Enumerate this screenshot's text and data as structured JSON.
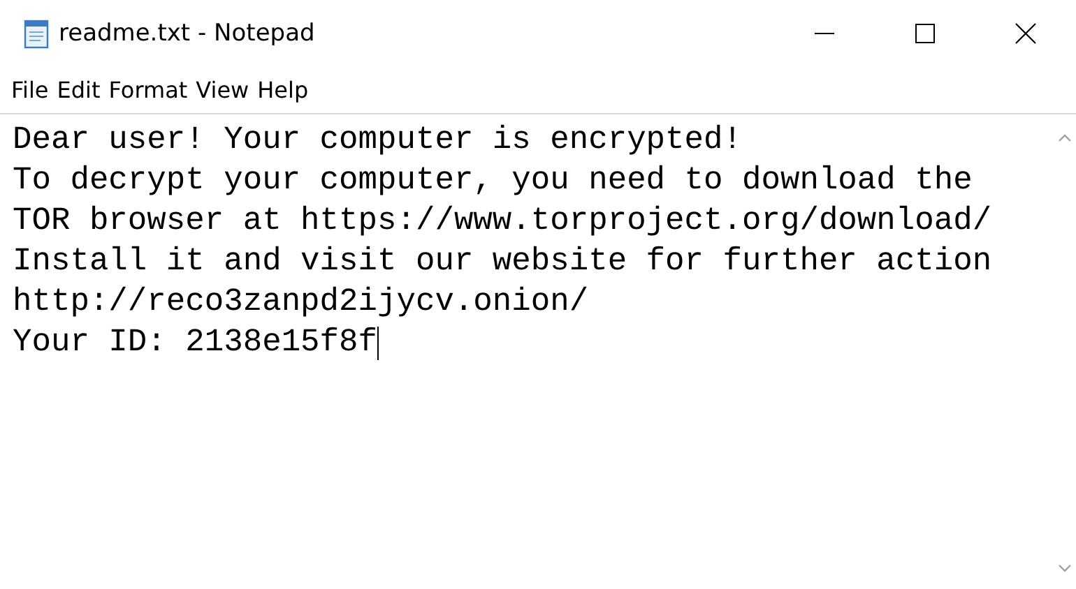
{
  "window": {
    "title": "readme.txt - Notepad"
  },
  "menu": [
    "File",
    "Edit",
    "Format",
    "View",
    "Help"
  ],
  "document": {
    "lines": [
      "Dear user! Your computer is encrypted!",
      "To decrypt your computer, you need to download the",
      "TOR browser at https://www.torproject.org/download/",
      "Install it and visit our website for further action",
      "http://reco3zanpd2ijycv.onion/",
      "Your ID: 2138e15f8f"
    ]
  }
}
